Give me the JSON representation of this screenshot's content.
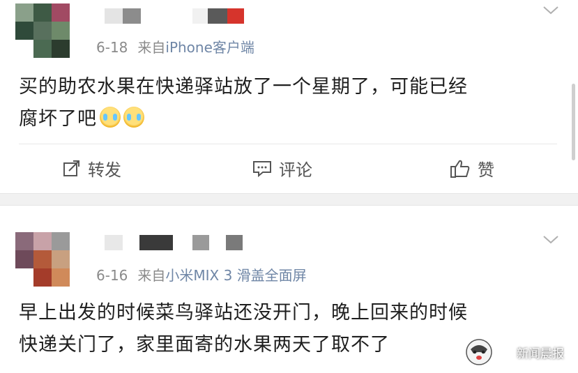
{
  "posts": [
    {
      "date": "6-18",
      "source_prefix": "来自",
      "source": "iPhone客户端",
      "content_lines": [
        "买的助农水果在快递驿站放了一个星期了，可能已经",
        "腐坏了吧"
      ],
      "emoji": "cry-laugh-emoji",
      "actions": {
        "repost": "转发",
        "comment": "评论",
        "like": "赞"
      }
    },
    {
      "date": "6-16",
      "source_prefix": "来自",
      "source": "小米MIX 3 滑盖全面屏",
      "content_lines": [
        "早上出发的时候菜鸟驿站还没开门，晚上回来的时候",
        "快递关门了，家里面寄的水果两天了取不了"
      ]
    }
  ],
  "watermark": {
    "text": "新闻晨报"
  },
  "colors": {
    "text": "#1e1e1e",
    "meta": "#8a8a8a",
    "source_link": "#6f86a6",
    "separator": "#f1f1f1"
  }
}
